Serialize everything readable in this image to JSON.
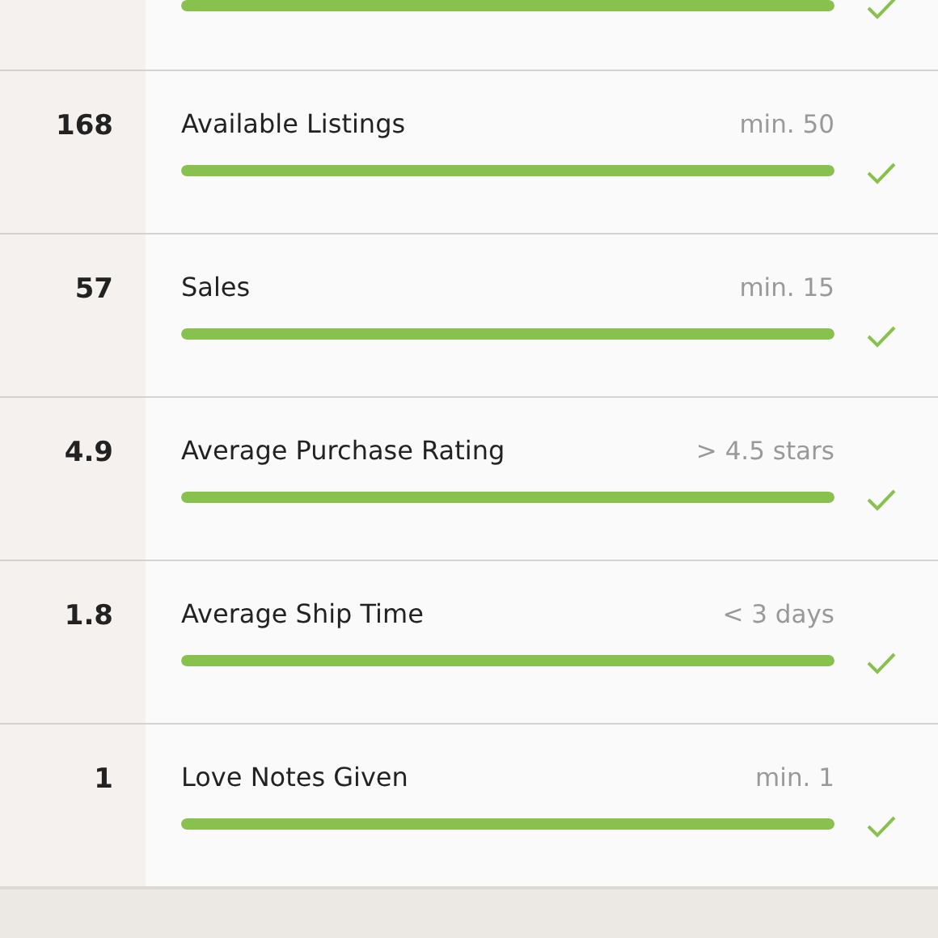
{
  "requirements": [
    {
      "level": 1,
      "met": true
    },
    {
      "value": "168",
      "label": "Available Listings",
      "target": "min. 50",
      "level": 1,
      "met": true
    },
    {
      "value": "57",
      "label": "Sales",
      "target": "min. 15",
      "level": 1,
      "met": true
    },
    {
      "value": "4.9",
      "label": "Average Purchase Rating",
      "target": "> 4.5 stars",
      "level": 1,
      "met": true
    },
    {
      "value": "1.8",
      "label": "Average Ship Time",
      "target": "< 3 days",
      "level": 1,
      "met": true
    },
    {
      "value": "1",
      "label": "Love Notes Given",
      "target": "min. 1",
      "level": 1,
      "met": true
    }
  ]
}
